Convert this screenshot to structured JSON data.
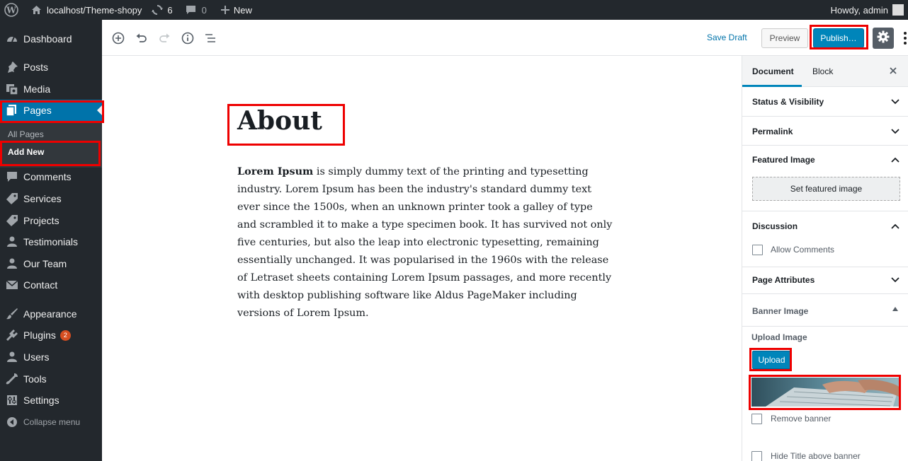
{
  "adminbar": {
    "site_name": "localhost/Theme-shopy",
    "updates_count": "6",
    "comments_count": "0",
    "new_label": "New",
    "howdy": "Howdy, admin"
  },
  "sidebar": {
    "dashboard": "Dashboard",
    "posts": "Posts",
    "media": "Media",
    "pages": "Pages",
    "all_pages": "All Pages",
    "add_new": "Add New",
    "comments": "Comments",
    "services": "Services",
    "projects": "Projects",
    "testimonials": "Testimonials",
    "our_team": "Our Team",
    "contact": "Contact",
    "appearance": "Appearance",
    "plugins": "Plugins",
    "plugins_badge": "2",
    "users": "Users",
    "tools": "Tools",
    "settings": "Settings",
    "collapse": "Collapse menu"
  },
  "toolbar": {
    "save_draft": "Save Draft",
    "preview": "Preview",
    "publish": "Publish…"
  },
  "editor": {
    "title": "About",
    "body_bold": "Lorem Ipsum",
    "body_rest": " is simply dummy text of the printing and typesetting industry. Lorem Ipsum has been the industry's standard dummy text ever since the 1500s, when an unknown printer took a galley of type and scrambled it to make a type specimen book. It has survived not only five centuries, but also the leap into electronic typesetting, remaining essentially unchanged. It was popularised in the 1960s with the release of Letraset sheets containing Lorem Ipsum passages, and more recently with desktop publishing software like Aldus PageMaker including versions of Lorem Ipsum."
  },
  "panel": {
    "tab_document": "Document",
    "tab_block": "Block",
    "status_visibility": "Status & Visibility",
    "permalink": "Permalink",
    "featured_image": "Featured Image",
    "set_featured": "Set featured image",
    "discussion": "Discussion",
    "allow_comments": "Allow Comments",
    "page_attributes": "Page Attributes",
    "banner_image": "Banner Image",
    "upload_image": "Upload Image",
    "upload": "Upload",
    "remove_banner": "Remove banner",
    "hide_title": "Hide Title above banner"
  },
  "colors": {
    "admin_dark": "#23282d",
    "accent_blue": "#0073aa",
    "highlight_red": "#ee0000"
  }
}
